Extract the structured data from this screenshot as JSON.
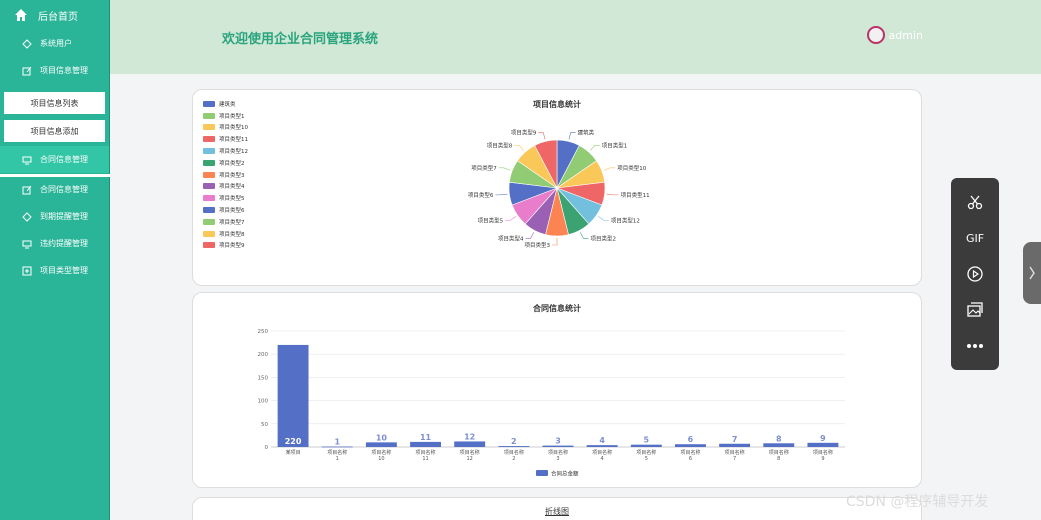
{
  "sidebar": {
    "home_label": "后台首页",
    "items": [
      {
        "label": "系统用户"
      },
      {
        "label": "项目信息管理"
      },
      {
        "label": "项目信息列表"
      },
      {
        "label": "项目信息添加"
      },
      {
        "label": "合同信息管理"
      },
      {
        "label": "合同信息管理"
      },
      {
        "label": "到期提醒管理"
      },
      {
        "label": "违约提醒管理"
      },
      {
        "label": "项目类型管理"
      }
    ]
  },
  "header": {
    "title": "欢迎使用企业合同管理系统",
    "user": "admin"
  },
  "card1": {
    "title": "项目信息统计"
  },
  "card2": {
    "title": "合同信息统计"
  },
  "card3": {
    "title": "折线图"
  },
  "watermark": "CSDN @程序辅导开发",
  "toolbar": {
    "gif": "GIF"
  },
  "chart_data": [
    {
      "type": "pie",
      "title": "项目信息统计",
      "labels": [
        "建筑类",
        "项目类型1",
        "项目类型10",
        "项目类型11",
        "项目类型12",
        "项目类型2",
        "项目类型3",
        "项目类型4",
        "项目类型5",
        "项目类型6",
        "项目类型7",
        "项目类型8",
        "项目类型9"
      ],
      "values": [
        1,
        1,
        1,
        1,
        1,
        1,
        1,
        1,
        1,
        1,
        1,
        1,
        1
      ],
      "colors": [
        "#5470c6",
        "#91cc75",
        "#fac858",
        "#ee6666",
        "#73c0de",
        "#3ba272",
        "#fc8452",
        "#9a60b4",
        "#ea7ccc",
        "#5470c6",
        "#91cc75",
        "#fac858",
        "#ee6666"
      ],
      "legend": "left"
    },
    {
      "type": "bar",
      "title": "合同信息统计",
      "categories": [
        "某项目",
        "项目名称1",
        "项目名称10",
        "项目名称11",
        "项目名称12",
        "项目名称2",
        "项目名称3",
        "项目名称4",
        "项目名称5",
        "项目名称6",
        "项目名称7",
        "项目名称8",
        "项目名称9"
      ],
      "series": [
        {
          "name": "合同总金额",
          "values": [
            220,
            1,
            10,
            11,
            12,
            2,
            3,
            4,
            5,
            6,
            7,
            8,
            9
          ]
        }
      ],
      "ylim": [
        0,
        250
      ],
      "yticks": [
        0,
        50,
        100,
        150,
        200,
        250
      ],
      "color": "#5470c6",
      "grid": true,
      "legend": "bottom"
    }
  ]
}
